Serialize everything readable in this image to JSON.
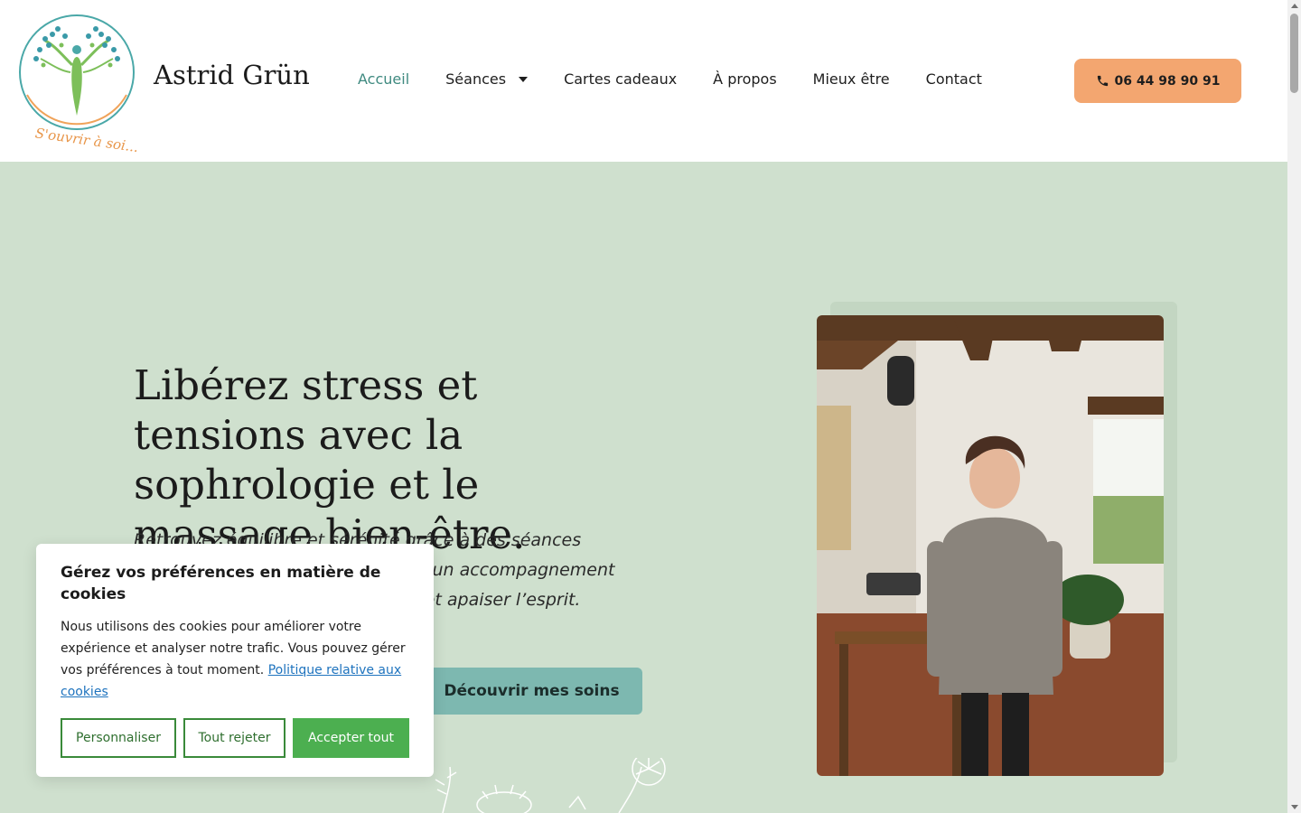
{
  "header": {
    "brand_name": "Astrid Grün",
    "logo_tagline": "S'ouvrir à soi...",
    "nav": [
      {
        "label": "Accueil",
        "active": true
      },
      {
        "label": "Séances",
        "has_dropdown": true
      },
      {
        "label": "Cartes cadeaux"
      },
      {
        "label": "À propos"
      },
      {
        "label": "Mieux être"
      },
      {
        "label": "Contact"
      }
    ],
    "phone_label": "06 44 98 90 91",
    "phone_icon": "phone-icon"
  },
  "hero": {
    "headline": "Libérez stress et tensions avec la sophrologie et le massage bien-être.",
    "subtext": "Retrouvez équilibre et sérénité grâce à des séances personnalisées et bienveillantes d’un accompagnement holistique pour détendre le corps et apaiser l’esprit.",
    "cta_label": "Découvrir mes soins"
  },
  "cookie_banner": {
    "title": "Gérez vos préférences en matière de cookies",
    "text": "Nous utilisons des cookies pour améliorer votre expérience et analyser notre trafic. Vous pouvez gérer vos préférences à tout moment.",
    "policy_link": "Politique relative aux cookies",
    "buttons": {
      "customize": "Personnaliser",
      "reject": "Tout rejeter",
      "accept": "Accepter tout"
    }
  },
  "colors": {
    "hero_bg": "#cfe0ce",
    "accent_teal": "#3f8a80",
    "phone_button": "#f3a670",
    "cta_button": "#7db8b0",
    "cookie_green": "#4caf50"
  }
}
